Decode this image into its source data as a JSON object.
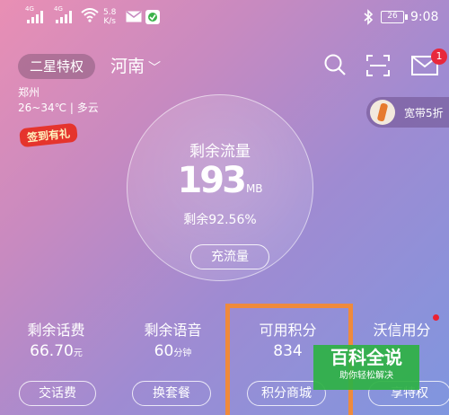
{
  "status_bar": {
    "signal1": "4G",
    "signal2": "4G",
    "speed_value": "5.8",
    "speed_unit": "K/s",
    "battery": "26",
    "time": "9:08"
  },
  "header": {
    "member_label": "二星特权",
    "region": "河南",
    "message_badge": "1"
  },
  "weather": {
    "city": "郑州",
    "forecast": "26~34℃ | 多云"
  },
  "signin_label": "签到有礼",
  "promo_label": "宽带5折",
  "data_card": {
    "title": "剩余流量",
    "amount": "193",
    "unit": "MB",
    "remaining_text": "剩余92.56%",
    "button": "充流量"
  },
  "stats": [
    {
      "label": "剩余话费",
      "value": "66.70",
      "unit": "元",
      "button": "交话费"
    },
    {
      "label": "剩余语音",
      "value": "60",
      "unit": "分钟",
      "button": "换套餐"
    },
    {
      "label": "可用积分",
      "value": "834",
      "unit": "",
      "button": "积分商城"
    },
    {
      "label": "沃信用分",
      "value": "",
      "unit": "",
      "button": "享特权"
    }
  ],
  "watermark": {
    "title": "百科全说",
    "subtitle": "助你轻松解决"
  },
  "colors": {
    "highlight": "#ef8a3c",
    "badge": "#e8283c",
    "watermark": "#2eb245"
  }
}
